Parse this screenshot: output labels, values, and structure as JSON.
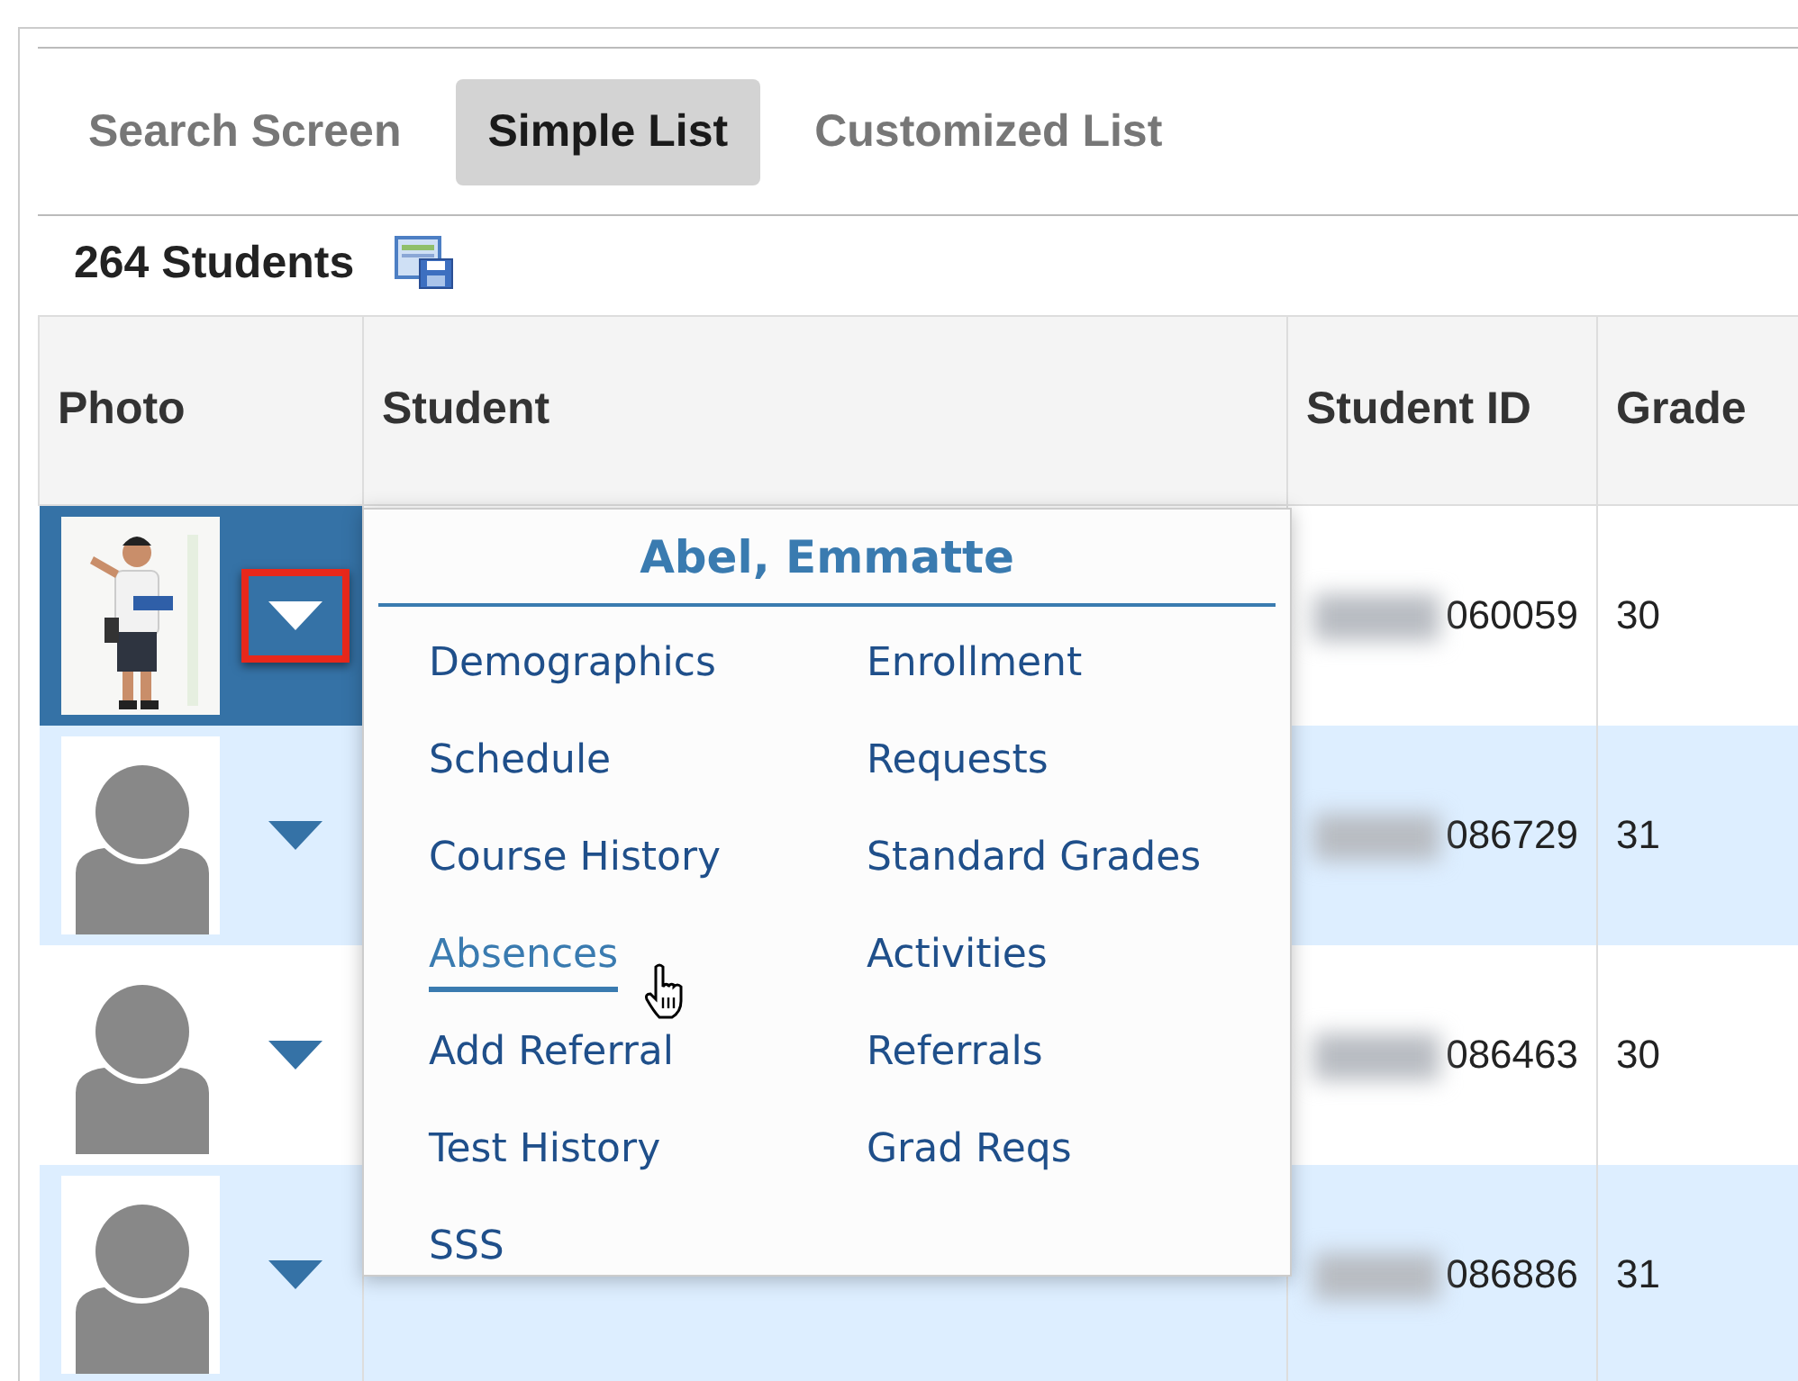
{
  "tabs": [
    {
      "label": "Search Screen",
      "selected": false
    },
    {
      "label": "Simple List",
      "selected": true
    },
    {
      "label": "Customized List",
      "selected": false
    }
  ],
  "count": "264 Students",
  "table": {
    "columns": [
      "Photo",
      "Student",
      "Student ID",
      "Grade"
    ],
    "rows": [
      {
        "selected": true,
        "menu_highlighted": true,
        "student_id": "060059",
        "grade": "30"
      },
      {
        "photo": {
          "kind": "avatar"
        },
        "selected": false,
        "menu_highlighted": false,
        "student_id": "086729",
        "grade": "31"
      },
      {
        "photo": {
          "kind": "avatar"
        },
        "selected": false,
        "menu_highlighted": false,
        "student_id": "086463",
        "grade": "30"
      },
      {
        "photo": {
          "kind": "avatar"
        },
        "selected": false,
        "menu_highlighted": false,
        "student_id": "086886",
        "grade": "31"
      }
    ]
  },
  "popup": {
    "title": "Abel, Emmatte",
    "items": [
      {
        "label": "Demographics",
        "hovered": false
      },
      {
        "label": "Enrollment",
        "hovered": false
      },
      {
        "label": "Schedule",
        "hovered": false
      },
      {
        "label": "Requests",
        "hovered": false
      },
      {
        "label": "Course History",
        "hovered": false
      },
      {
        "label": "Standard Grades",
        "hovered": false
      },
      {
        "label": "Absences",
        "hovered": true
      },
      {
        "label": "Activities",
        "hovered": false
      },
      {
        "label": "Add Referral",
        "hovered": false
      },
      {
        "label": "Referrals",
        "hovered": false
      },
      {
        "label": "Test History",
        "hovered": false
      },
      {
        "label": "Grad Reqs",
        "hovered": false
      },
      {
        "label": "SSS",
        "hovered": false
      }
    ]
  }
}
